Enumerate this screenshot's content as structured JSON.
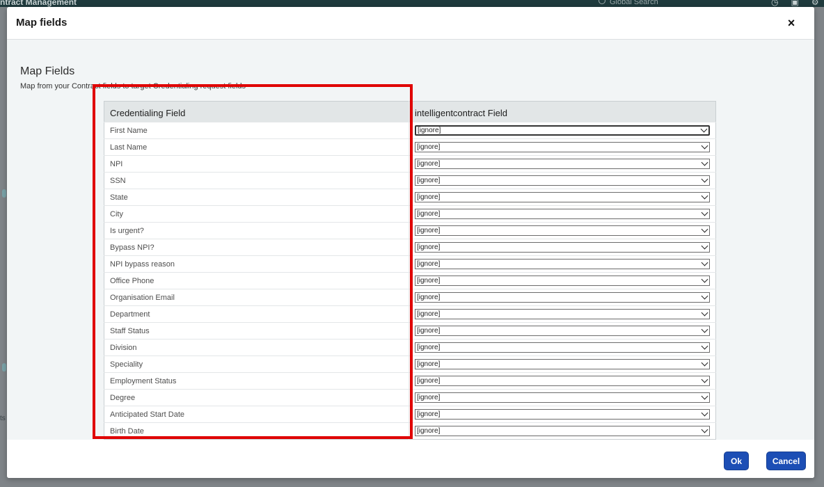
{
  "background": {
    "app_title": "ntract Management",
    "search_placeholder": "Global Search",
    "side_text": "ts"
  },
  "modal": {
    "title": "Map fields",
    "close_label": "×",
    "section_title": "Map Fields",
    "section_desc": "Map from your Contract fields to target Credentialing request fields",
    "table": {
      "headers": [
        "Credentialing Field",
        "intelligentcontract Field"
      ],
      "rows": [
        {
          "field": "First Name",
          "value": "[ignore]"
        },
        {
          "field": "Last Name",
          "value": "[ignore]"
        },
        {
          "field": "NPI",
          "value": "[ignore]"
        },
        {
          "field": "SSN",
          "value": "[ignore]"
        },
        {
          "field": "State",
          "value": "[ignore]"
        },
        {
          "field": "City",
          "value": "[ignore]"
        },
        {
          "field": "Is urgent?",
          "value": "[ignore]"
        },
        {
          "field": "Bypass NPI?",
          "value": "[ignore]"
        },
        {
          "field": "NPI bypass reason",
          "value": "[ignore]"
        },
        {
          "field": "Office Phone",
          "value": "[ignore]"
        },
        {
          "field": "Organisation Email",
          "value": "[ignore]"
        },
        {
          "field": "Department",
          "value": "[ignore]"
        },
        {
          "field": "Staff Status",
          "value": "[ignore]"
        },
        {
          "field": "Division",
          "value": "[ignore]"
        },
        {
          "field": "Speciality",
          "value": "[ignore]"
        },
        {
          "field": "Employment Status",
          "value": "[ignore]"
        },
        {
          "field": "Degree",
          "value": "[ignore]"
        },
        {
          "field": "Anticipated Start Date",
          "value": "[ignore]"
        },
        {
          "field": "Birth Date",
          "value": "[ignore]"
        }
      ]
    },
    "footer": {
      "ok_label": "Ok",
      "cancel_label": "Cancel"
    }
  },
  "colors": {
    "primary_button": "#1c4eb5",
    "highlight": "#e00000",
    "header_bg": "#e2e6e7"
  }
}
